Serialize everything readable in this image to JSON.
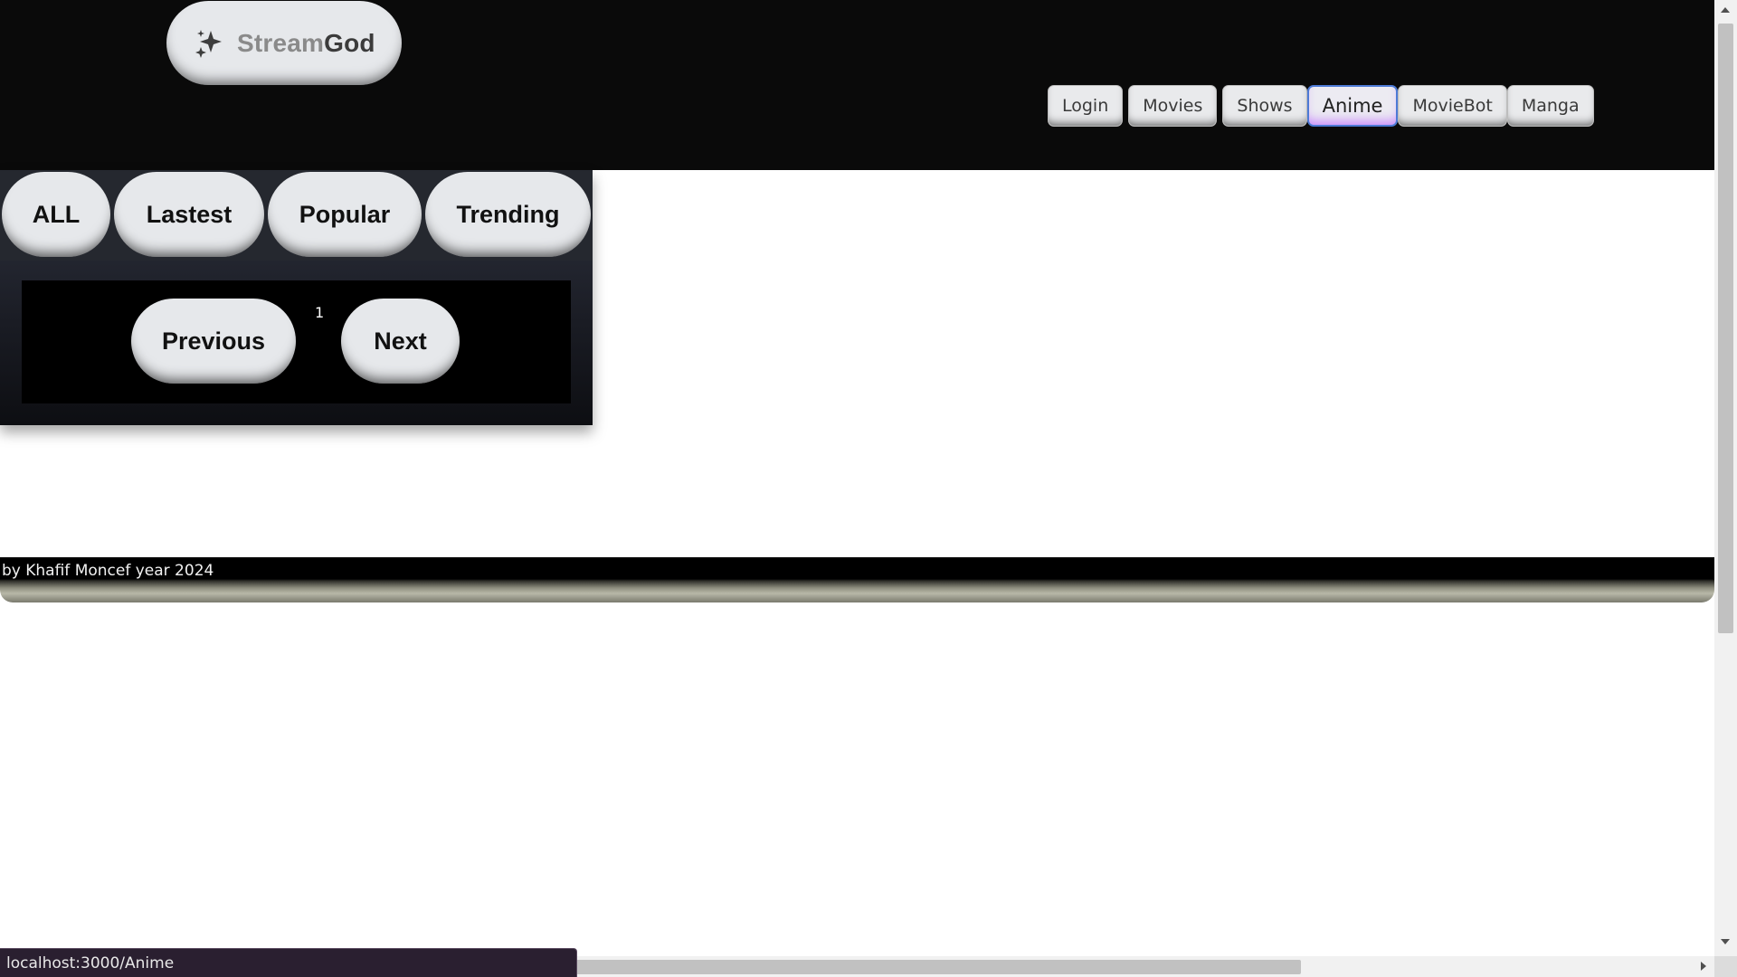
{
  "brand": {
    "name_light": "Stream",
    "name_bold": "God",
    "icon": "sparkles-icon"
  },
  "nav": {
    "items": [
      {
        "label": "Login",
        "active": false
      },
      {
        "label": "Movies",
        "active": false
      },
      {
        "label": "Shows",
        "active": false
      },
      {
        "label": "Anime",
        "active": true
      },
      {
        "label": "MovieBot",
        "active": false
      },
      {
        "label": "Manga",
        "active": false
      }
    ]
  },
  "categories": [
    "ALL",
    "Lastest",
    "Popular",
    "Trending"
  ],
  "pager": {
    "previous": "Previous",
    "page": "1",
    "next": "Next"
  },
  "footer": {
    "credit": "by Khafif Moncef year 2024"
  },
  "status_bar": {
    "url": "localhost:3000/Anime"
  },
  "colors": {
    "header_bg": "#0a0a0a",
    "button_bg": "#e6e8eb",
    "active_border": "#4d7ad6",
    "active_glow": "#be6eff"
  }
}
